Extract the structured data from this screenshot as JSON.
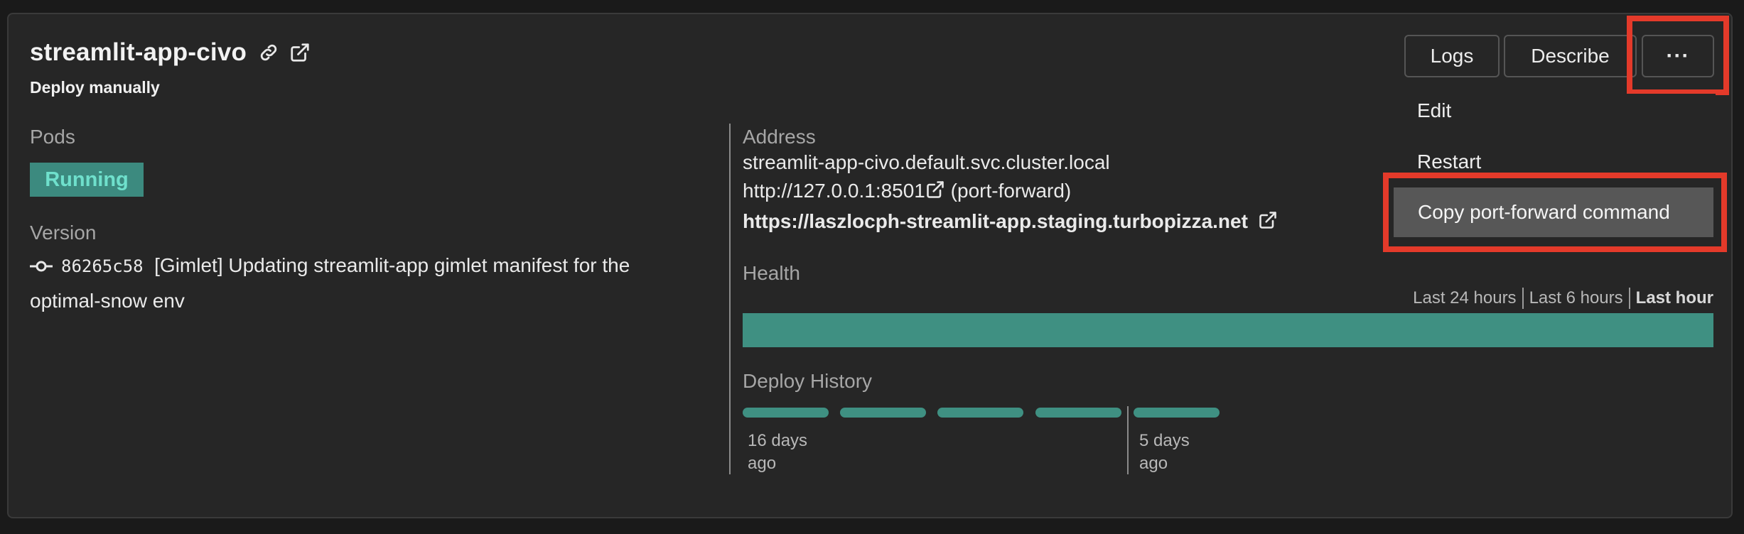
{
  "service": {
    "name": "streamlit-app-civo",
    "subtitle": "Deploy manually"
  },
  "pods": {
    "label": "Pods",
    "status": "Running"
  },
  "version": {
    "label": "Version",
    "commit_hash": "86265c58",
    "message_line1": "[Gimlet] Updating streamlit-app gimlet manifest for the",
    "message_line2": "optimal-snow env"
  },
  "address": {
    "label": "Address",
    "internal": "streamlit-app-civo.default.svc.cluster.local",
    "local_url": "http://127.0.0.1:8501",
    "local_suffix": "(port-forward)",
    "public_url": "https://laszlocph-streamlit-app.staging.turbopizza.net"
  },
  "health": {
    "label": "Health",
    "ranges": [
      "Last 24 hours",
      "Last 6 hours",
      "Last hour"
    ],
    "active_range": "Last hour"
  },
  "deploy_history": {
    "label": "Deploy History",
    "markers": [
      {
        "line1": "16 days",
        "line2": "ago"
      },
      {
        "line1": "5 days",
        "line2": "ago"
      }
    ]
  },
  "actions": {
    "logs": "Logs",
    "describe": "Describe",
    "more": "···"
  },
  "menu": {
    "items": [
      "Edit",
      "Restart",
      "Copy port-forward command"
    ]
  },
  "colors": {
    "accent": "#3f9082",
    "running_text": "#6fe0cc",
    "highlight": "#e43a2a"
  }
}
